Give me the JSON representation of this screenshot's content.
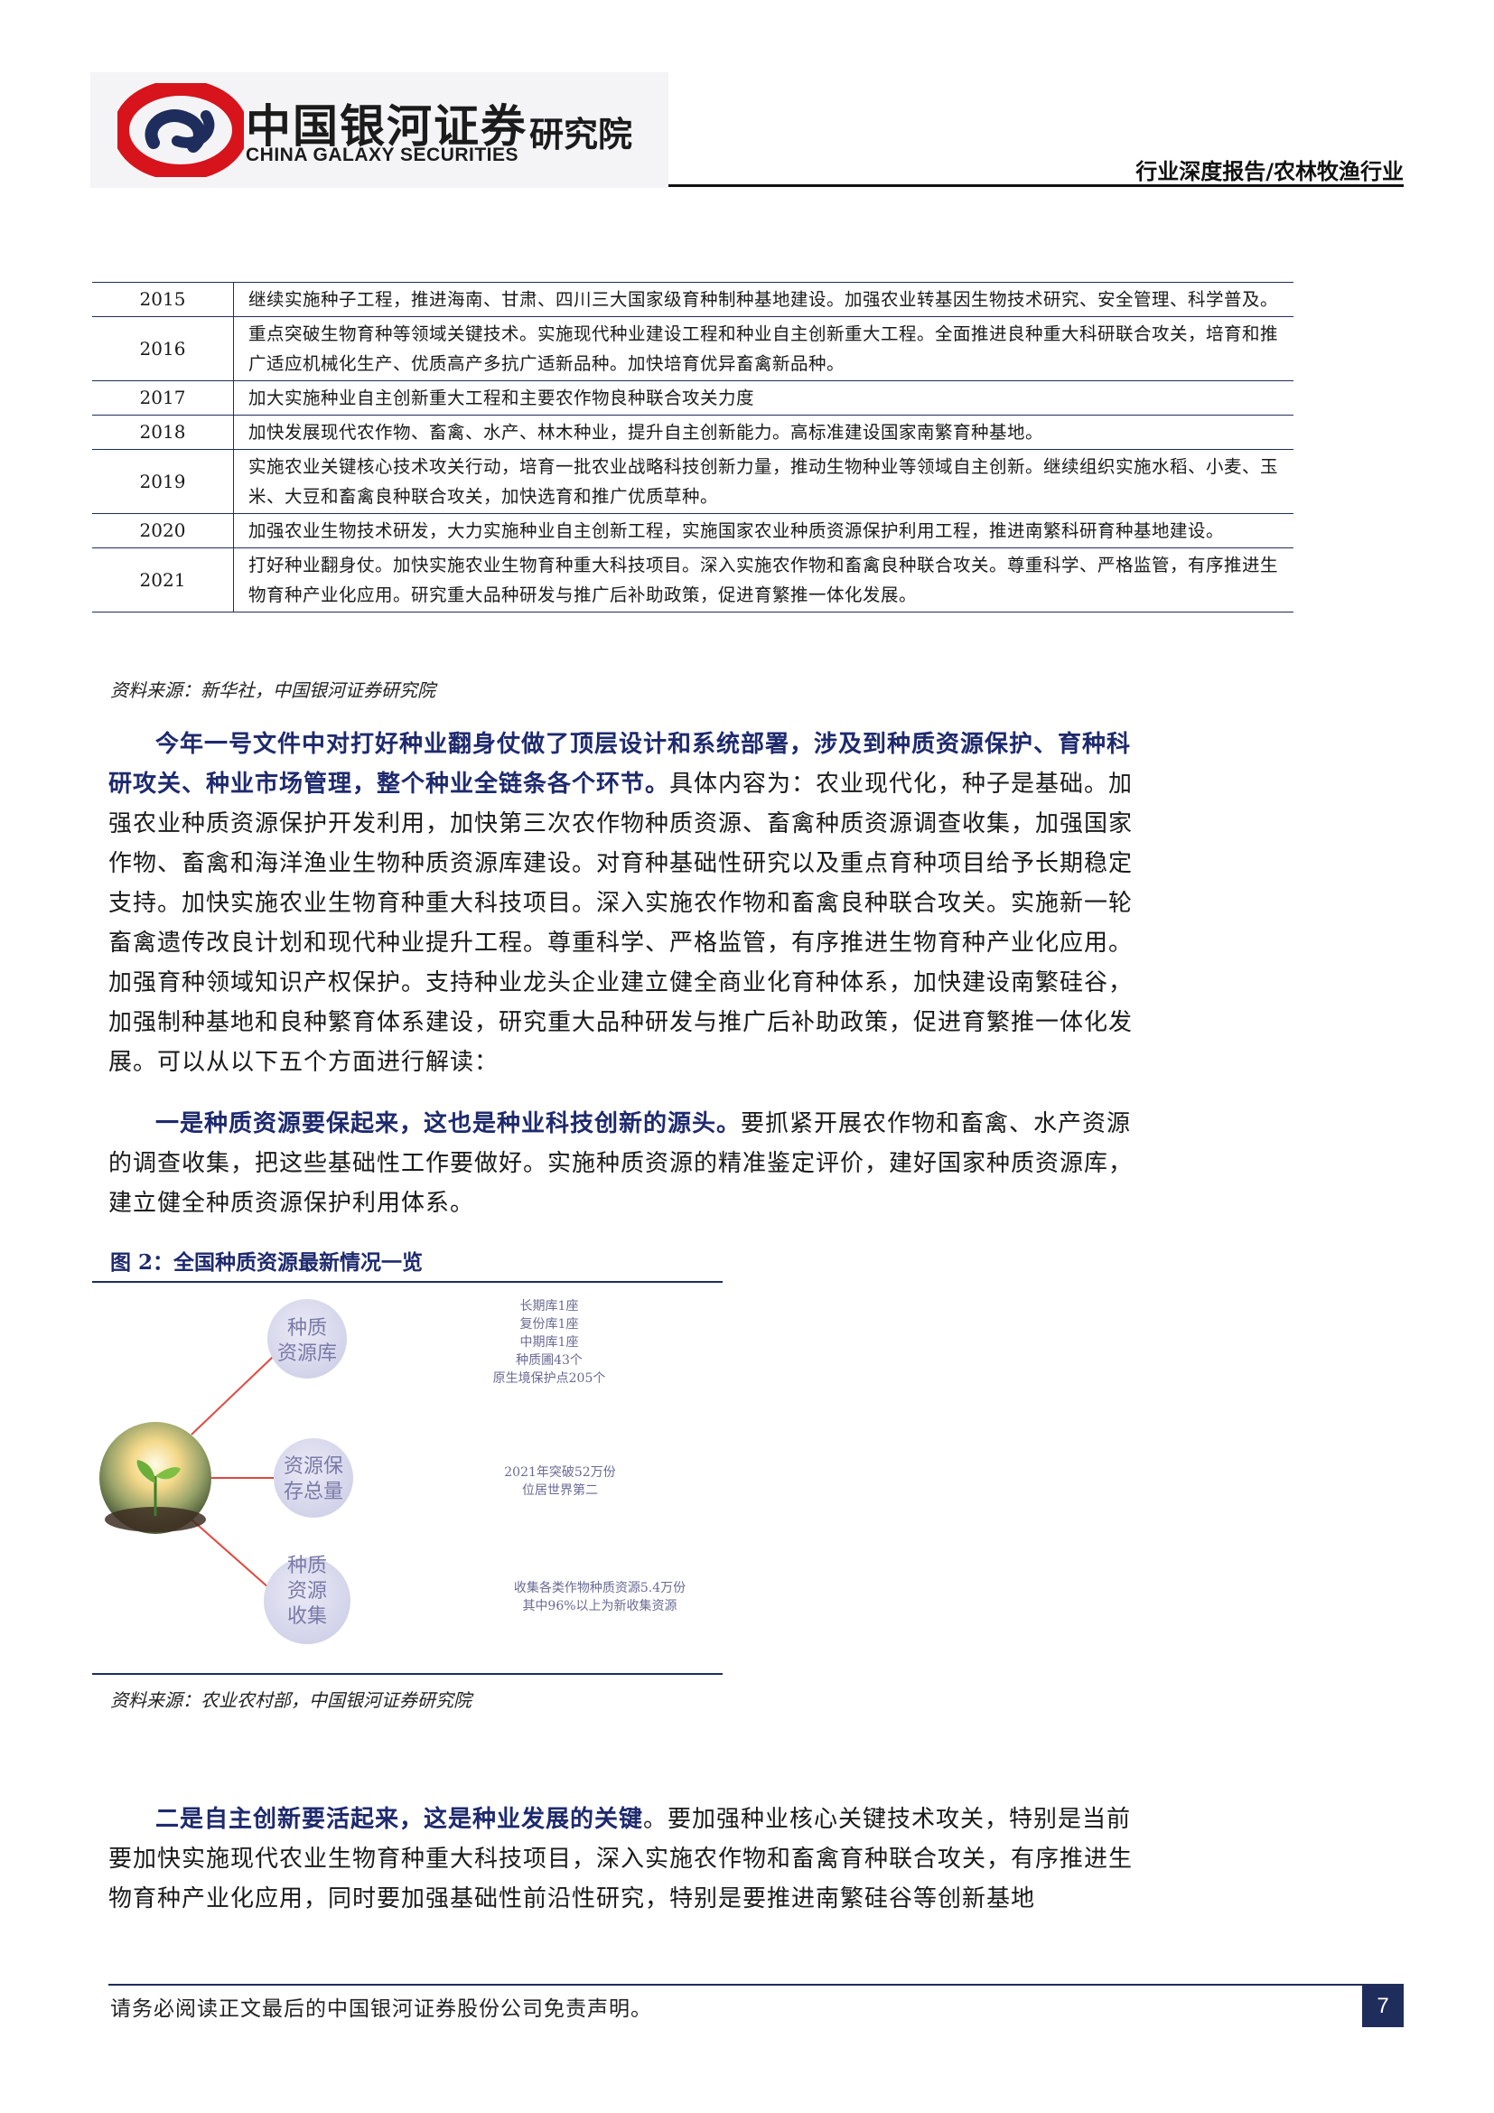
{
  "header": {
    "brand_cn": "中国银河证券",
    "brand_en": "CHINA GALAXY SECURITIES",
    "brand_institute": "研究院",
    "report_type": "行业深度报告/农林牧渔行业"
  },
  "policy_table": {
    "rows": [
      {
        "year": "2015",
        "text": "继续实施种子工程，推进海南、甘肃、四川三大国家级育种制种基地建设。加强农业转基因生物技术研究、安全管理、科学普及。"
      },
      {
        "year": "2016",
        "text": "重点突破生物育种等领域关键技术。实施现代种业建设工程和种业自主创新重大工程。全面推进良种重大科研联合攻关，培育和推广适应机械化生产、优质高产多抗广适新品种。加快培育优异畜禽新品种。"
      },
      {
        "year": "2017",
        "text": "加大实施种业自主创新重大工程和主要农作物良种联合攻关力度"
      },
      {
        "year": "2018",
        "text": "加快发展现代农作物、畜禽、水产、林木种业，提升自主创新能力。高标准建设国家南繁育种基地。"
      },
      {
        "year": "2019",
        "text": "实施农业关键核心技术攻关行动，培育一批农业战略科技创新力量，推动生物种业等领域自主创新。继续组织实施水稻、小麦、玉米、大豆和畜禽良种联合攻关，加快选育和推广优质草种。"
      },
      {
        "year": "2020",
        "text": "加强农业生物技术研发，大力实施种业自主创新工程，实施国家农业种质资源保护利用工程，推进南繁科研育种基地建设。"
      },
      {
        "year": "2021",
        "text": "打好种业翻身仗。加快实施农业生物育种重大科技项目。深入实施农作物和畜禽良种联合攻关。尊重科学、严格监管，有序推进生物育种产业化应用。研究重大品种研发与推广后补助政策，促进育繁推一体化发展。"
      }
    ],
    "source": "资料来源：新华社，中国银河证券研究院"
  },
  "paragraphs": {
    "p1_bold": "今年一号文件中对打好种业翻身仗做了顶层设计和系统部署，涉及到种质资源保护、育种科研攻关、种业市场管理，整个种业全链条各个环节。",
    "p1_rest": "具体内容为：农业现代化，种子是基础。加强农业种质资源保护开发利用，加快第三次农作物种质资源、畜禽种质资源调查收集，加强国家作物、畜禽和海洋渔业生物种质资源库建设。对育种基础性研究以及重点育种项目给予长期稳定支持。加快实施农业生物育种重大科技项目。深入实施农作物和畜禽良种联合攻关。实施新一轮畜禽遗传改良计划和现代种业提升工程。尊重科学、严格监管，有序推进生物育种产业化应用。加强育种领域知识产权保护。支持种业龙头企业建立健全商业化育种体系，加快建设南繁硅谷，加强制种基地和良种繁育体系建设，研究重大品种研发与推广后补助政策，促进育繁推一体化发展。可以从以下五个方面进行解读：",
    "p2_bold": "一是种质资源要保起来，这也是种业科技创新的源头。",
    "p2_rest": "要抓紧开展农作物和畜禽、水产资源的调查收集，把这些基础性工作要做好。实施种质资源的精准鉴定评价，建好国家种质资源库，建立健全种质资源保护利用体系。",
    "p3_bold": "二是自主创新要活起来，这是种业发展的关键",
    "p3_rest": "。要加强种业核心关键技术攻关，特别是当前要加快实施现代农业生物育种重大科技项目，深入实施农作物和畜禽育种联合攻关，有序推进生物育种产业化应用，同时要加强基础性前沿性研究，特别是要推进南繁硅谷等创新基地"
  },
  "figure": {
    "title": "图 2：全国种质资源最新情况一览",
    "bubbles": [
      {
        "line1": "种质",
        "line2": "资源库",
        "line3": ""
      },
      {
        "line1": "资源保",
        "line2": "存总量",
        "line3": ""
      },
      {
        "line1": "种质",
        "line2": "资源",
        "line3": "收集"
      }
    ],
    "notes_1": [
      "长期库1座",
      "复份库1座",
      "中期库1座",
      "种质圃43个",
      "原生境保护点205个"
    ],
    "notes_2": [
      "2021年突破52万份",
      "位居世界第二"
    ],
    "notes_3": [
      "收集各类作物种质资源5.4万份",
      "其中96%以上为新收集资源"
    ],
    "source": "资料来源：农业农村部，中国银河证券研究院"
  },
  "footer": {
    "disclaimer": "请务必阅读正文最后的中国银河证券股份公司免责声明。",
    "page_number": "7"
  },
  "colors": {
    "brand_red": "#d7131b",
    "navy": "#1f2d5c",
    "bubble": "#d6d7ec",
    "bubble_text": "#7a7aa8",
    "connector": "#e2483e"
  }
}
